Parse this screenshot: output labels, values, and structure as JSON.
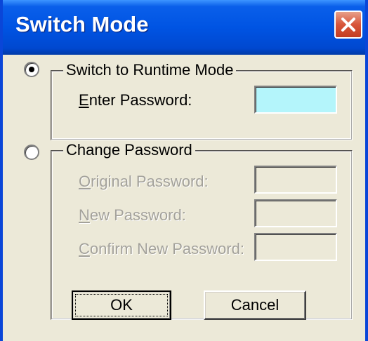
{
  "window": {
    "title": "Switch Mode"
  },
  "runtime_group": {
    "label": "Switch to Runtime Mode",
    "radio_selected": true,
    "password_label_prefix": "E",
    "password_label_rest": "nter Password:",
    "password_value": ""
  },
  "change_group": {
    "label": "Change Password",
    "radio_selected": false,
    "original_prefix": "O",
    "original_rest": "riginal Password:",
    "new_prefix": "N",
    "new_rest": "ew Password:",
    "confirm_prefix": "C",
    "confirm_rest": "onfirm New Password:"
  },
  "buttons": {
    "ok_label": "OK",
    "cancel_label": "Cancel"
  },
  "colors": {
    "titlebar": "#0054e3",
    "active_field": "#b4f5fb",
    "disabled_text": "#a3a19a"
  }
}
